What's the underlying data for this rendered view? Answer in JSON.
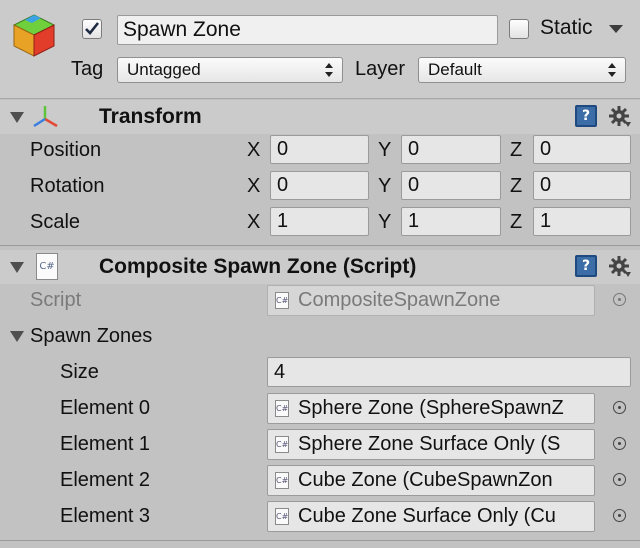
{
  "gameobject": {
    "active": true,
    "name": "Spawn Zone",
    "static_label": "Static",
    "static_checked": false,
    "tag_label": "Tag",
    "tag_value": "Untagged",
    "layer_label": "Layer",
    "layer_value": "Default"
  },
  "transform": {
    "title": "Transform",
    "rows": [
      {
        "label": "Position",
        "x": "0",
        "y": "0",
        "z": "0"
      },
      {
        "label": "Rotation",
        "x": "0",
        "y": "0",
        "z": "0"
      },
      {
        "label": "Scale",
        "x": "1",
        "y": "1",
        "z": "1"
      }
    ],
    "axis": {
      "x": "X",
      "y": "Y",
      "z": "Z"
    }
  },
  "script_component": {
    "title": "Composite Spawn Zone (Script)",
    "script_label": "Script",
    "script_value": "CompositeSpawnZone",
    "icon_text": "C#",
    "spawn_zones": {
      "label": "Spawn Zones",
      "size_label": "Size",
      "size_value": "4",
      "elements": [
        {
          "label": "Element 0",
          "value": "Sphere Zone (SphereSpawnZ"
        },
        {
          "label": "Element 1",
          "value": "Sphere Zone Surface Only (S"
        },
        {
          "label": "Element 2",
          "value": "Cube Zone (CubeSpawnZon"
        },
        {
          "label": "Element 3",
          "value": "Cube Zone Surface Only (Cu"
        }
      ]
    }
  },
  "icons": {
    "help": "?",
    "gameobject": "gameobject-cube-icon",
    "transform": "transform-axes-icon",
    "settings": "gear-icon"
  }
}
